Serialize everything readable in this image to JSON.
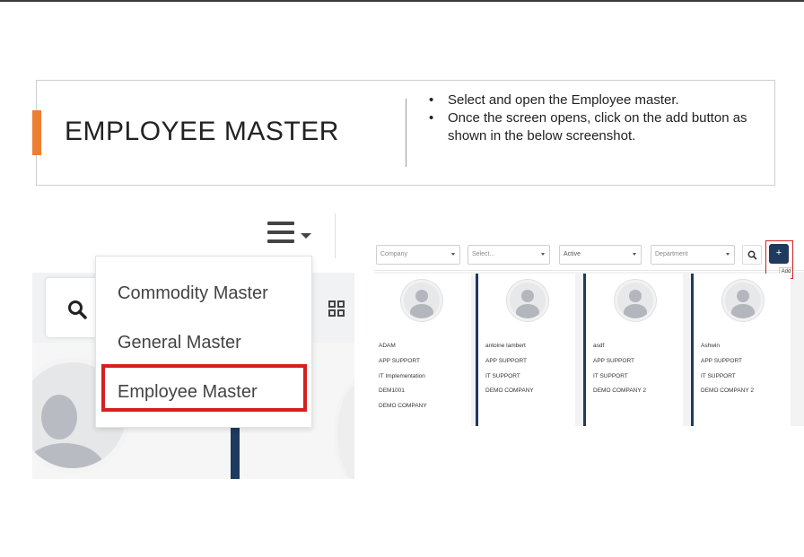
{
  "slide": {
    "title": "EMPLOYEE MASTER",
    "bullets": [
      "Select and open the Employee master.",
      "Once the screen opens, click on the add button as shown in the below screenshot."
    ],
    "accent_color": "#ed7d31"
  },
  "left_screenshot": {
    "menu_icon": "hamburger-menu-icon",
    "menu_items": [
      "Commodity Master",
      "General Master",
      "Employee Master"
    ],
    "highlighted_item": "Employee Master",
    "highlight_color": "#d61f1f"
  },
  "right_screenshot": {
    "filters": {
      "company_placeholder": "Company",
      "select_placeholder": "Select...",
      "status_value": "Active",
      "department_placeholder": "Department"
    },
    "add_button": {
      "label": "+",
      "tooltip": "Add",
      "color": "#1e3a5f"
    },
    "employees": [
      {
        "name": "ADAM",
        "lines": [
          "APP SUPPORT",
          "IT Implementation",
          "DEM1001",
          "DEMO COMPANY"
        ]
      },
      {
        "name": "antoine lambert",
        "lines": [
          "APP SUPPORT",
          "IT SUPPORT",
          "DEMO COMPANY"
        ]
      },
      {
        "name": "asdf",
        "lines": [
          "APP SUPPORT",
          "IT SUPPORT",
          "DEMO COMPANY 2"
        ]
      },
      {
        "name": "Ashwin",
        "lines": [
          "APP SUPPORT",
          "IT SUPPORT",
          "DEMO COMPANY 2"
        ]
      }
    ]
  }
}
